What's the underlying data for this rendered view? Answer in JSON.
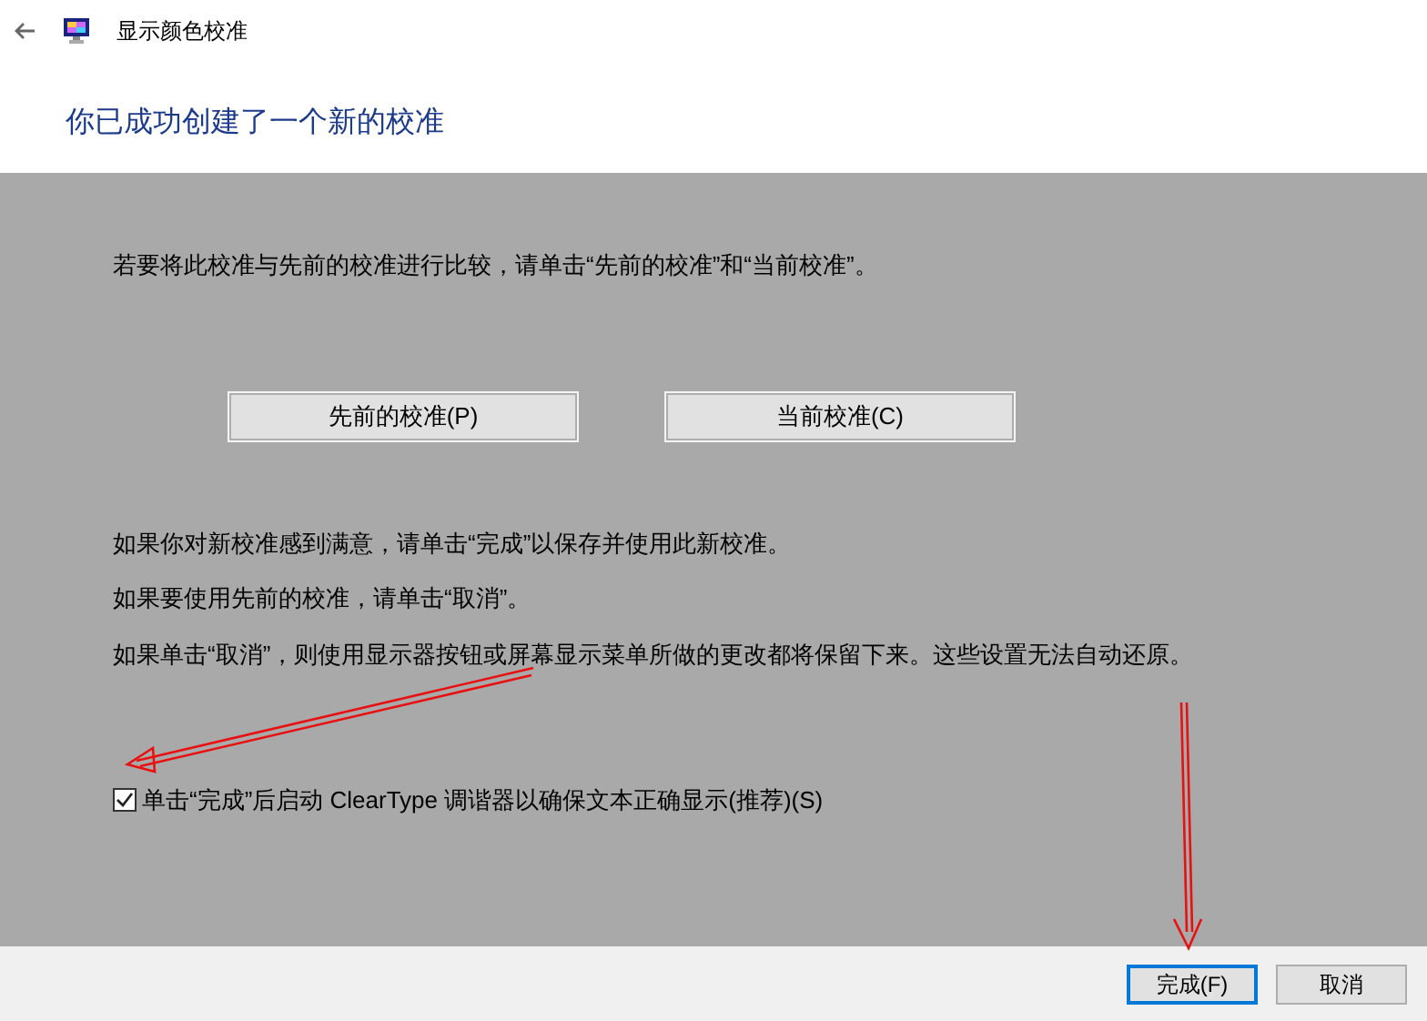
{
  "window": {
    "title": "显示颜色校准"
  },
  "heading": "你已成功创建了一个新的校准",
  "intro": "若要将此校准与先前的校准进行比较，请单击“先前的校准”和“当前校准”。",
  "compare_buttons": [
    "先前的校准(P)",
    "当前校准(C)"
  ],
  "notes": [
    "如果你对新校准感到满意，请单击“完成”以保存并使用此新校准。",
    "如果要使用先前的校准，请单击“取消”。",
    "如果单击“取消”，则使用显示器按钮或屏幕显示菜单所做的更改都将保留下来。这些设置无法自动还原。"
  ],
  "checkbox": {
    "label": "单击“完成”后启动 ClearType 调谐器以确保文本正确显示(推荐)(S)",
    "checked": true
  },
  "footer_buttons": [
    {
      "label": "完成(F)",
      "focused": true
    },
    {
      "label": "取消",
      "focused": false
    }
  ]
}
